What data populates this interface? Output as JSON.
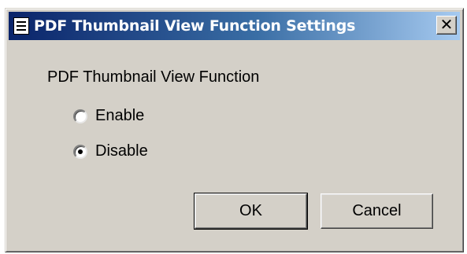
{
  "window": {
    "title": "PDF Thumbnail View Function Settings",
    "close_glyph": "✕"
  },
  "group": {
    "label": "PDF Thumbnail View Function",
    "options": [
      {
        "label": "Enable",
        "selected": false
      },
      {
        "label": "Disable",
        "selected": true
      }
    ]
  },
  "buttons": {
    "ok_label": "OK",
    "cancel_label": "Cancel"
  },
  "colors": {
    "face": "#d4d0c8",
    "titlebar_start": "#0a246a",
    "titlebar_end": "#a6caf0"
  },
  "icons": {
    "app": "document-window-icon",
    "close": "close-icon"
  }
}
